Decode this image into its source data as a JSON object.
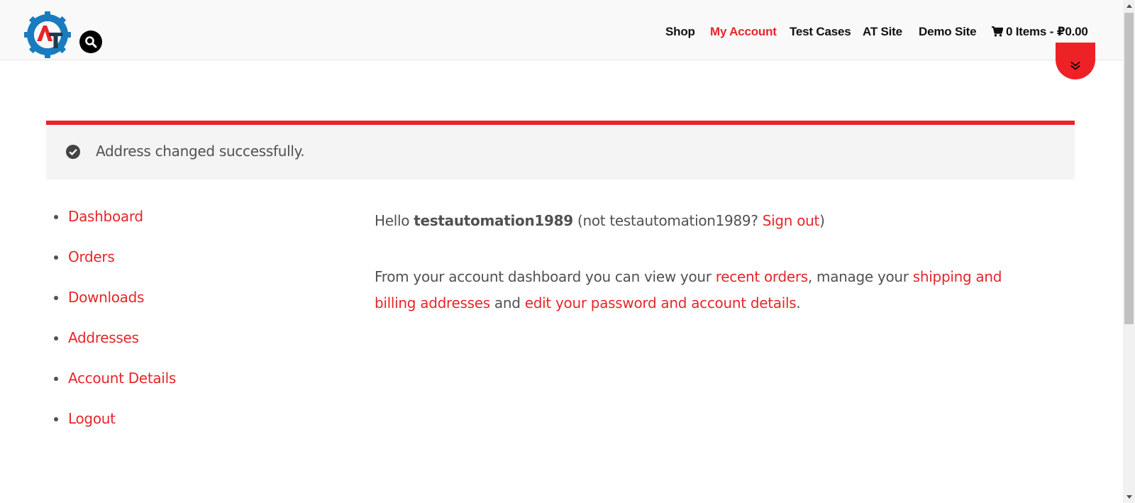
{
  "header": {
    "logo_text": "AT",
    "nav": [
      {
        "label": "Shop",
        "active": false
      },
      {
        "label": "My Account",
        "active": true
      },
      {
        "label": "Test Cases",
        "active": false
      },
      {
        "label": "AT Site",
        "active": false
      },
      {
        "label": "Demo Site",
        "active": false
      }
    ],
    "cart_label": "0 Items - ₽0.00",
    "icons": [
      "search-icon",
      "cart-icon",
      "double-chevron-down-icon"
    ]
  },
  "notice": {
    "text": "Address changed successfully.",
    "icon": "check-circle-icon"
  },
  "account_nav": [
    "Dashboard",
    "Orders",
    "Downloads",
    "Addresses",
    "Account Details",
    "Logout"
  ],
  "dashboard": {
    "hello": "Hello",
    "username": "testautomation1989",
    "not_prefix": "(not testautomation1989?",
    "sign_out": "Sign out",
    "not_suffix": ")",
    "intro": "From your account dashboard you can view your",
    "recent_orders": "recent orders",
    "manage": ", manage your",
    "addresses_link": "shipping and billing addresses",
    "and": "and",
    "account_link": "edit your password and account details",
    "period": "."
  },
  "colors": {
    "accent": "#e5262a",
    "text": "#515151",
    "notice_bg": "#f4f4f4",
    "header_bg": "#f9f9f9"
  }
}
